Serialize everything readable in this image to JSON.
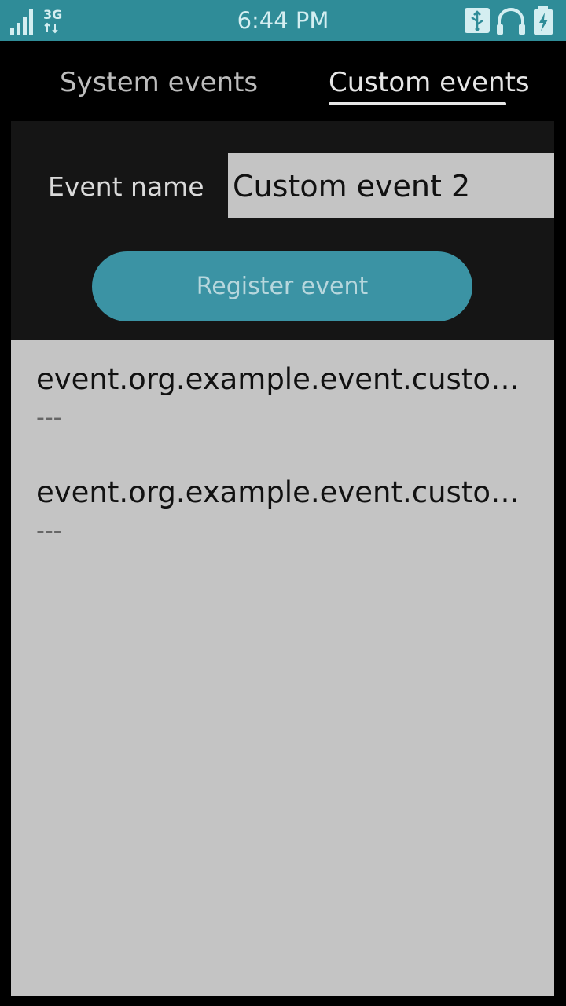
{
  "status_bar": {
    "time": "6:44 PM",
    "network": "3G",
    "icons": [
      "signal-icon",
      "network-3g-icon",
      "usb-icon",
      "headphones-icon",
      "battery-charging-icon"
    ]
  },
  "tabs": [
    {
      "label": "System events",
      "active": false
    },
    {
      "label": "Custom events",
      "active": true
    }
  ],
  "form": {
    "event_name_label": "Event name",
    "event_name_value": "Custom event 2",
    "register_button": "Register event"
  },
  "events": [
    {
      "name": "event.org.example.event.custom…",
      "value": "---"
    },
    {
      "name": "event.org.example.event.custom…",
      "value": "---"
    }
  ],
  "colors": {
    "status_bar": "#2f8c98",
    "accent_button": "#3b93a4",
    "panel": "#151515",
    "list_background": "#c4c4c4"
  }
}
